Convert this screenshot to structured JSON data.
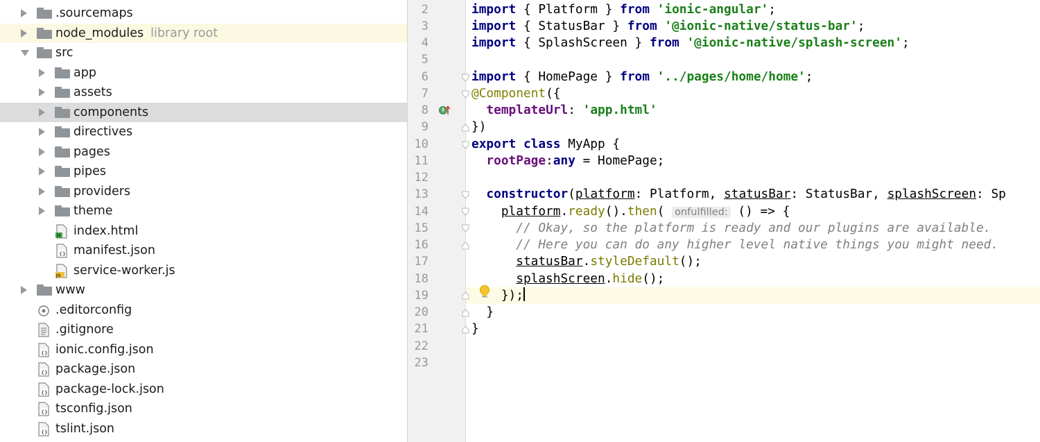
{
  "tree": {
    "items": [
      {
        "label": ".sourcemaps",
        "hint": "",
        "icon": "folder-icon"
      },
      {
        "label": "node_modules",
        "hint": "library root",
        "icon": "folder-icon"
      },
      {
        "label": "src",
        "hint": "",
        "icon": "folder-icon"
      },
      {
        "label": "app",
        "hint": "",
        "icon": "folder-icon"
      },
      {
        "label": "assets",
        "hint": "",
        "icon": "folder-icon"
      },
      {
        "label": "components",
        "hint": "",
        "icon": "folder-icon"
      },
      {
        "label": "directives",
        "hint": "",
        "icon": "folder-icon"
      },
      {
        "label": "pages",
        "hint": "",
        "icon": "folder-icon"
      },
      {
        "label": "pipes",
        "hint": "",
        "icon": "folder-icon"
      },
      {
        "label": "providers",
        "hint": "",
        "icon": "folder-icon"
      },
      {
        "label": "theme",
        "hint": "",
        "icon": "folder-icon"
      },
      {
        "label": "index.html",
        "hint": "",
        "icon": "html-file-icon"
      },
      {
        "label": "manifest.json",
        "hint": "",
        "icon": "json-file-icon"
      },
      {
        "label": "service-worker.js",
        "hint": "",
        "icon": "js-file-icon"
      },
      {
        "label": "www",
        "hint": "",
        "icon": "folder-icon"
      },
      {
        "label": ".editorconfig",
        "hint": "",
        "icon": "editorconfig-file-icon"
      },
      {
        "label": ".gitignore",
        "hint": "",
        "icon": "text-file-icon"
      },
      {
        "label": "ionic.config.json",
        "hint": "",
        "icon": "json-file-icon"
      },
      {
        "label": "package.json",
        "hint": "",
        "icon": "json-file-icon"
      },
      {
        "label": "package-lock.json",
        "hint": "",
        "icon": "json-file-icon"
      },
      {
        "label": "tsconfig.json",
        "hint": "",
        "icon": "json-file-icon"
      },
      {
        "label": "tslint.json",
        "hint": "",
        "icon": "json-file-icon"
      }
    ],
    "html_badge": "H",
    "js_badge": "JS",
    "json_badge": "{}"
  },
  "editor": {
    "line_numbers": [
      "2",
      "3",
      "4",
      "5",
      "6",
      "7",
      "8",
      "9",
      "10",
      "11",
      "12",
      "13",
      "14",
      "15",
      "16",
      "17",
      "18",
      "19",
      "20",
      "21",
      "22",
      "23"
    ],
    "tokens": {
      "import": "import",
      "from": "from",
      "export": "export",
      "class": "class",
      "any": "any",
      "constructor": "constructor",
      "l2_brace": " { Platform } ",
      "l2_str": "'ionic-angular'",
      "l3_brace": " { StatusBar } ",
      "l3_str": "'@ionic-native/status-bar'",
      "l4_brace": " { SplashScreen } ",
      "l4_str": "'@ionic-native/splash-screen'",
      "l6_brace": " { HomePage } ",
      "l6_str": "'../pages/home/home'",
      "semi": ";",
      "l7_ann": "@Component",
      "l7_rest": "({",
      "l8_indent": "  ",
      "l8_field": "templateUrl",
      "l8_colon": ": ",
      "l8_str": "'app.html'",
      "l9": "})",
      "l10_name": " MyApp {",
      "l11_field": "rootPage",
      "l11_colon": ":",
      "l11_rest": " = HomePage;",
      "l13_open": "(",
      "l13_p1": "platform",
      "l13_t1": ": Platform, ",
      "l13_p2": "statusBar",
      "l13_t2": ": StatusBar, ",
      "l13_p3": "splashScreen",
      "l13_t3": ": Sp",
      "l14_obj": "platform",
      "l14_dot1": ".",
      "l14_m1": "ready",
      "l14_mid": "().",
      "l14_m2": "then",
      "l14_open": "( ",
      "l14_hint": "onfulfilled:",
      "l14_rest": " () => {",
      "l15": "// Okay, so the platform is ready and our plugins are available.",
      "l16": "// Here you can do any higher level native things you might need.",
      "l17_obj": "statusBar",
      "l17_dot": ".",
      "l17_m": "styleDefault",
      "l17_rest": "();",
      "l18_obj": "splashScreen",
      "l18_dot": ".",
      "l18_m": "hide",
      "l18_rest": "();",
      "l19": "});",
      "l20": "}",
      "l21": "}"
    }
  },
  "colors": {
    "keyword": "#000080",
    "string": "#1a7f1a",
    "field": "#660e7a",
    "annotation": "#808000",
    "comment": "#808080",
    "selected_row": "#dcdcdc",
    "library_row": "#fbf9e2",
    "current_line": "#fdfbe4"
  }
}
